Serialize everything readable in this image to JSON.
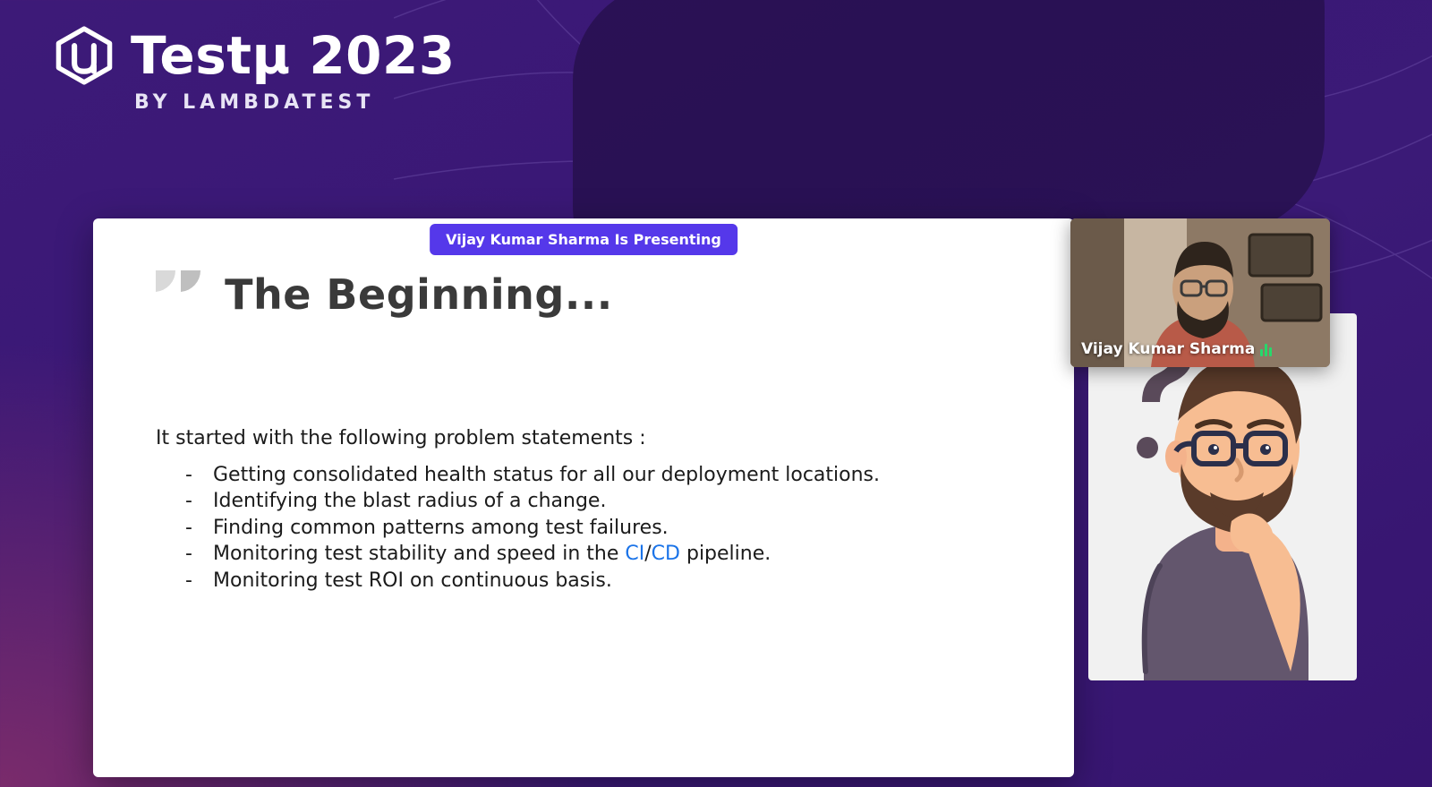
{
  "header": {
    "title": "Testµ 2023",
    "subtitle": "BY LAMBDATEST"
  },
  "presenting_badge": "Vijay Kumar Sharma Is Presenting",
  "slide": {
    "title": "The Beginning...",
    "intro": "It started with the following problem statements :",
    "bullets": [
      "Getting consolidated health status for all our deployment locations.",
      "Identifying the blast radius of a change.",
      "Finding common patterns among test failures.",
      "Monitoring test stability and speed in the ",
      "Monitoring test ROI on continuous basis."
    ],
    "pipeline_link_ci": "CI",
    "pipeline_link_sep": "/",
    "pipeline_link_cd": "CD",
    "pipeline_suffix": " pipeline."
  },
  "presenter": {
    "name": "Vijay Kumar Sharma"
  }
}
